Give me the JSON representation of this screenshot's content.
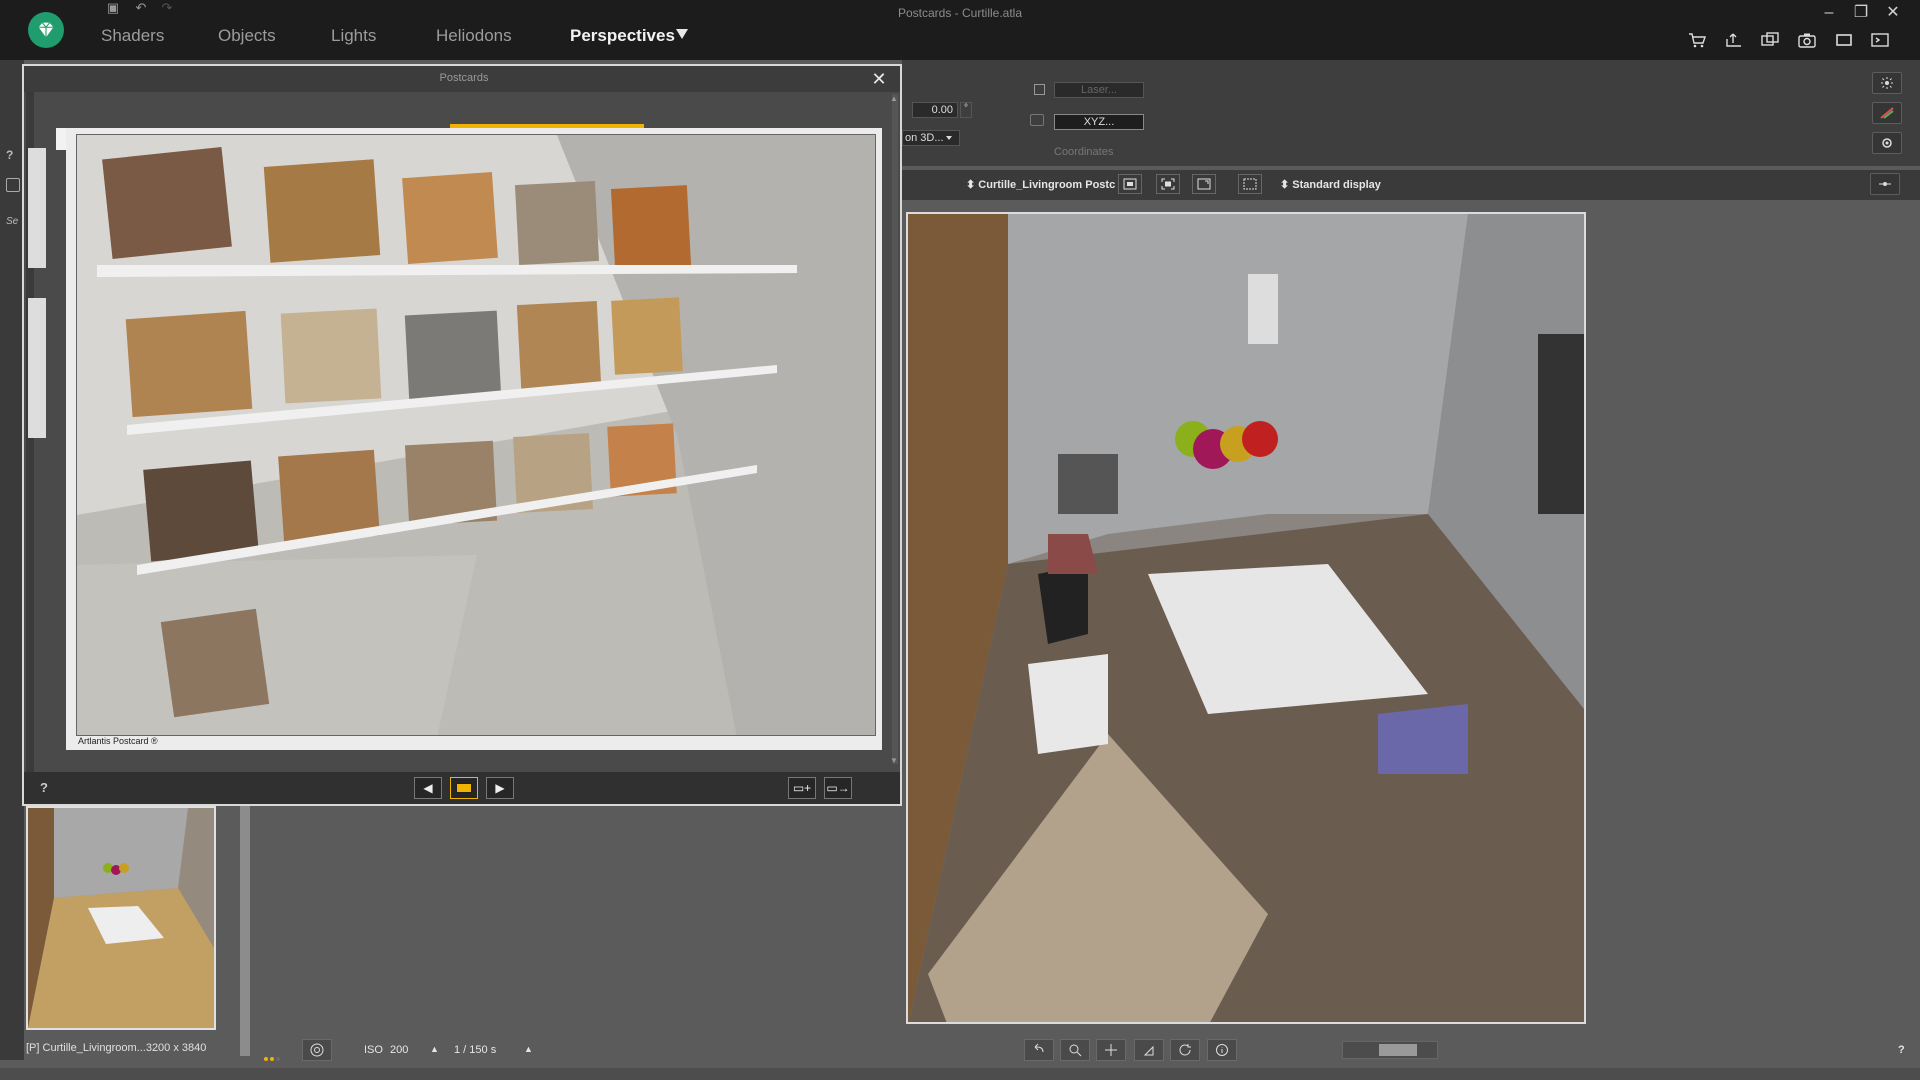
{
  "window": {
    "title": "Postcards - Curtille.atla",
    "controls": {
      "minimize": "–",
      "restore": "❐",
      "close": "✕"
    }
  },
  "tabs": [
    {
      "label": "Shaders"
    },
    {
      "label": "Objects"
    },
    {
      "label": "Lights"
    },
    {
      "label": "Heliodons"
    },
    {
      "label": "Perspectives"
    }
  ],
  "left_strip": {
    "help": "?",
    "label_se": "Se"
  },
  "properties": {
    "angle_value": "0.00",
    "angle_unit": "°",
    "mode_select": "on 3D...",
    "laser_button": "Laser...",
    "xyz_button": "XYZ...",
    "coordinates_label": "Coordinates"
  },
  "viewport": {
    "perspective_select": "Curtille_Livingroom Postc",
    "display_select": "Standard display"
  },
  "postcards_dialog": {
    "title": "Postcards",
    "close": "✕",
    "caption": "Artlantis Postcard ®",
    "help": "?",
    "prev": "◀",
    "next": "▶"
  },
  "thumbnail": {
    "caption": "[P] Curtille_Livingroom...3200 x 3840"
  },
  "bottom": {
    "iso_label": "ISO",
    "iso_value": "200",
    "shutter_value": "1 / 150 s",
    "help": "?"
  },
  "colors": {
    "accent": "#f0b400",
    "logo": "#1f9d6e",
    "topbar": "#1c1c1c",
    "panel": "#5b5b5b"
  },
  "icons": [
    "save-icon",
    "undo-icon",
    "redo-icon",
    "cart-icon",
    "export-icon",
    "windows-icon",
    "camera-icon",
    "crop-icon",
    "render-icon",
    "gear-icon",
    "search-icon",
    "pan-icon",
    "rotate-icon",
    "info-icon"
  ]
}
